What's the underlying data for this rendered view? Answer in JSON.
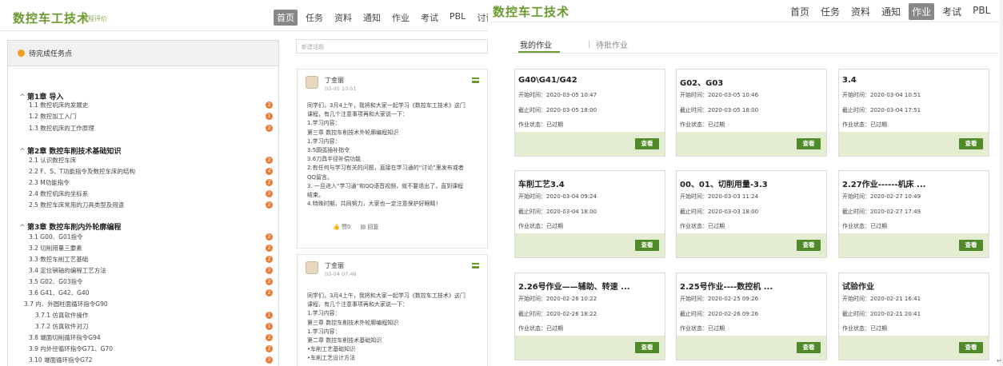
{
  "left": {
    "logo": "数控车工技术",
    "logo_sub": "课程评价",
    "nav": [
      "首页",
      "任务",
      "资料",
      "通知",
      "作业",
      "考试",
      "PBL",
      "讨论"
    ],
    "nav_active": 0,
    "task_header": "待完成任务点",
    "chapters": [
      {
        "title": "第1章 导入",
        "items": [
          {
            "label": "1.1  数控机床的发展史",
            "badge": "2"
          },
          {
            "label": "1.2  数控加工入门",
            "badge": "1"
          },
          {
            "label": "1.3  数控机床的工作原理",
            "badge": "2"
          }
        ]
      },
      {
        "title": "第2章 数控车削技术基础知识",
        "items": [
          {
            "label": "2.1  认识数控车床",
            "badge": "2"
          },
          {
            "label": "2.2  F、S、T功能指令及数控车床的结构",
            "badge": "4"
          },
          {
            "label": "2.3  M功能指令",
            "badge": "2"
          },
          {
            "label": "2.4  数控机床的坐标系",
            "badge": "2"
          },
          {
            "label": "2.5  数控车床常用的刀具类型及用途",
            "badge": "2"
          }
        ]
      },
      {
        "title": "第3章 数控车削内外轮廓编程",
        "items": [
          {
            "label": "3.1  G00、G01指令",
            "badge": "2"
          },
          {
            "label": "3.2  切削用量三要素",
            "badge": "2"
          },
          {
            "label": "3.3  数控车削工艺基础",
            "badge": "2"
          },
          {
            "label": "3.4  定位销轴的编程工艺方法",
            "badge": "2"
          },
          {
            "label": "3.5  G02、G03指令",
            "badge": "2"
          },
          {
            "label": "3.6  G41、G42、G40",
            "badge": "2"
          },
          {
            "label": "3.7  内、外圆柱面循环指令G90",
            "badge": ""
          },
          {
            "label": "3.7.1 仿真软件操作",
            "badge": "1"
          },
          {
            "label": "3.7.2 仿真软件对刀",
            "badge": "1"
          },
          {
            "label": "3.8  端面切削循环指令G94",
            "badge": "2"
          },
          {
            "label": "3.9  内外径循环指令G71、G70",
            "badge": "2"
          },
          {
            "label": "3.10  端面循环指令G72",
            "badge": "2"
          }
        ]
      }
    ],
    "new_topic_placeholder": "新建话题",
    "posts": [
      {
        "name": "丁金丽",
        "date": "03-05 10:51",
        "lines": [
          "同学们，3月4上午，我将和大家一起学习《数控车工技术》这门",
          "课程，有几个注意事项再和大家说一下：",
          "1.学习内容：",
          "第三章 数控车削技术外轮廓编程知识",
          "1.学习内容：",
          "3.5圆弧插补指令",
          "3.6刀具半径补偿功能",
          "2.有任何与学习有关的问题，直接在学习通的“讨论”里发布或者",
          "QQ留言。",
          "3. 一旦进入“学习通”和QQ语音视频，就不要退出了，直到课程",
          "结束。",
          "4.特殊时期，共同努力，大家也一定注意保护好眼睛！"
        ],
        "likes": "赞0",
        "reply": "回复"
      },
      {
        "name": "丁金丽",
        "date": "03-04 07:46",
        "lines": [
          "同学们，3月4上午，我将和大家一起学习《数控车工技术》这门",
          "课程，有几个注意事项再和大家说一下：",
          "1.学习内容：",
          "第三章 数控车削技术外轮廓编程知识",
          "1.学习内容：",
          "第二章 数控车削技术基础知识",
          "•车削工艺基础知识",
          "•车削工艺设计方法"
        ]
      }
    ]
  },
  "right": {
    "logo": "数控车工技术",
    "nav": [
      "首页",
      "任务",
      "资料",
      "通知",
      "作业",
      "考试",
      "PBL",
      "讨"
    ],
    "nav_active": 4,
    "tabs": [
      "我的作业",
      "待批作业"
    ],
    "start_label": "开始时间：",
    "end_label": "截止时间：",
    "status_label": "作业状态：",
    "button_label": "查看",
    "cards": [
      {
        "title": "G40\\G41/G42",
        "start": "2020-03-05 10:47",
        "end": "2020-03-05 18:00",
        "status": "已过期"
      },
      {
        "title": "G02、G03",
        "start": "2020-03-05 10:46",
        "end": "2020-03-05 18:00",
        "status": "已过期"
      },
      {
        "title": "3.4",
        "start": "2020-03-04 10:51",
        "end": "2020-03-04 17:51",
        "status": "已过期"
      },
      {
        "title": "车削工艺3.4",
        "start": "2020-03-04 09:24",
        "end": "2020-03-04 18:00",
        "status": "已过期"
      },
      {
        "title": "00、01、切削用量-3.3",
        "start": "2020-03-03 11:24",
        "end": "2020-03-03 18:00",
        "status": "已过期"
      },
      {
        "title": "2.27作业------机床 ...",
        "start": "2020-02-27 10:49",
        "end": "2020-02-27 17:49",
        "status": "已过期"
      },
      {
        "title": "2.26号作业——辅助、转速 ...",
        "start": "2020-02-26 10:22",
        "end": "2020-02-26 18:22",
        "status": "已过期"
      },
      {
        "title": "2.25号作业----数控机 ...",
        "start": "2020-02-25 09:26",
        "end": "2020-02-26 09:26",
        "status": "已过期"
      },
      {
        "title": "试验作业",
        "start": "2020-02-21 16:41",
        "end": "2020-02-21 20:41",
        "status": "已过期"
      }
    ]
  },
  "colors": {
    "accent_green": "#6a9a2e",
    "button_green": "#4e8a28",
    "badge_orange": "#ee7a3a",
    "card_footer": "#e4ecd2"
  },
  "icons": {
    "task_header": "orange-dot-icon",
    "post_menu": "menu-icon",
    "like": "thumbs-up-icon",
    "reply": "comment-icon",
    "chapter": "caret-up-icon"
  }
}
